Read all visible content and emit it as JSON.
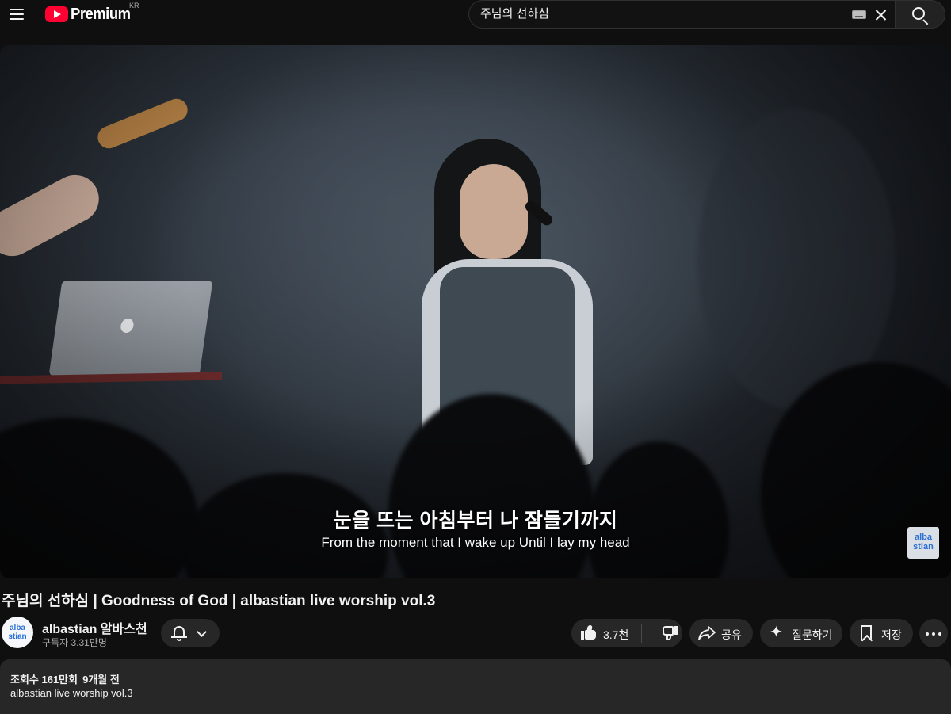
{
  "header": {
    "logo_text": "Premium",
    "country_code": "KR",
    "search": {
      "value": "주님의 선하심",
      "placeholder": "검색"
    }
  },
  "player": {
    "subtitle_korean": "눈을 뜨는 아침부터 나 잠들기까지",
    "subtitle_english": "From the moment that I wake up Until I lay my head",
    "watermark_line1": "alba",
    "watermark_line2": "stian"
  },
  "video": {
    "title": "주님의 선하심 | Goodness of God | albastian live worship vol.3",
    "channel": {
      "name": "albastian 알바스천",
      "subscribers": "구독자 3.31만명",
      "avatar_line1": "alba",
      "avatar_line2": "stian"
    },
    "actions": {
      "like_count": "3.7천",
      "share_label": "공유",
      "ask_label": "질문하기",
      "save_label": "저장"
    },
    "description": {
      "views": "조회수 161만회",
      "date": "9개월 전",
      "text": "albastian live worship vol.3"
    }
  },
  "colors": {
    "background": "#0f0f0f",
    "surface": "#272727",
    "brand_red": "#ff0033",
    "text": "#f1f1f1",
    "secondary_text": "#aaaaaa"
  }
}
